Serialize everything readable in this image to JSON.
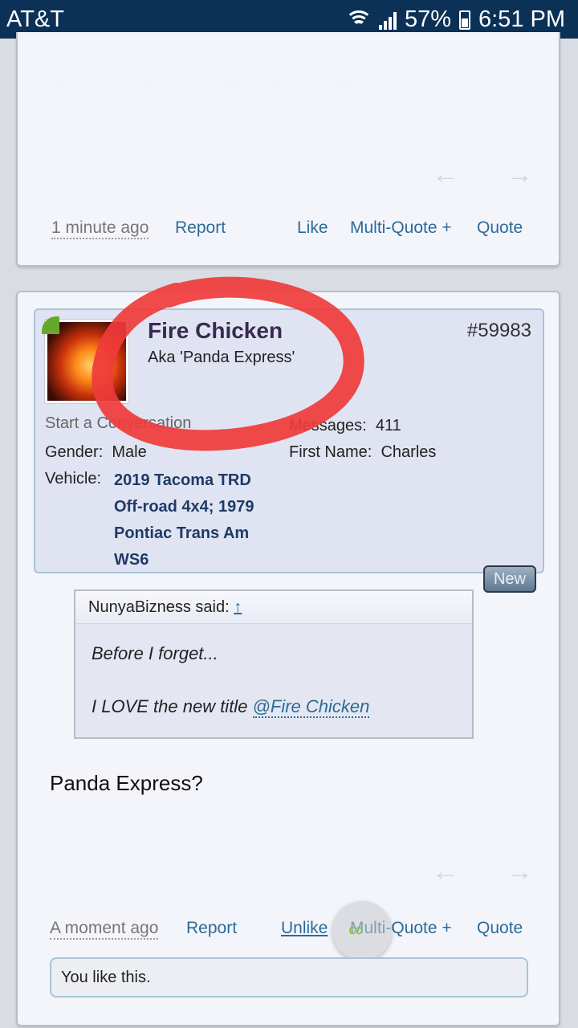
{
  "statusbar": {
    "carrier": "AT&T",
    "battery": "57%",
    "time": "6:51 PM"
  },
  "post1": {
    "faded_text": "I hope he sees this, I don't want him to get all whiny.",
    "time": "1 minute ago",
    "report": "Report",
    "like": "Like",
    "multiquote": "Multi-Quote +",
    "quote": "Quote"
  },
  "post2": {
    "username": "Fire Chicken",
    "user_title": "Aka 'Panda Express'",
    "post_number": "#59983",
    "start_conversation": "Start a Conversation",
    "messages_label": "Messages:",
    "messages_value": "411",
    "gender_label": "Gender:",
    "gender_value": "Male",
    "firstname_label": "First Name:",
    "firstname_value": "Charles",
    "vehicle_label": "Vehicle:",
    "vehicle_value": "2019 Tacoma TRD Off-road 4x4; 1979 Pontiac Trans Am WS6",
    "new_badge": "New",
    "quote_author": "NunyaBizness said:",
    "quote_arrow": "↑",
    "quote_line1": "Before I forget...",
    "quote_line2": "I LOVE the new title ",
    "quote_mention": "@Fire Chicken",
    "message": "Panda Express?",
    "time": "A moment ago",
    "report": "Report",
    "unlike": "Unlike",
    "multiquote": "Multi-Quote +",
    "quote": "Quote",
    "likes_text": "You like this."
  },
  "colors": {
    "statusbar": "#0c3157",
    "link": "#2a6b98",
    "annotation": "#ef3b3b"
  }
}
